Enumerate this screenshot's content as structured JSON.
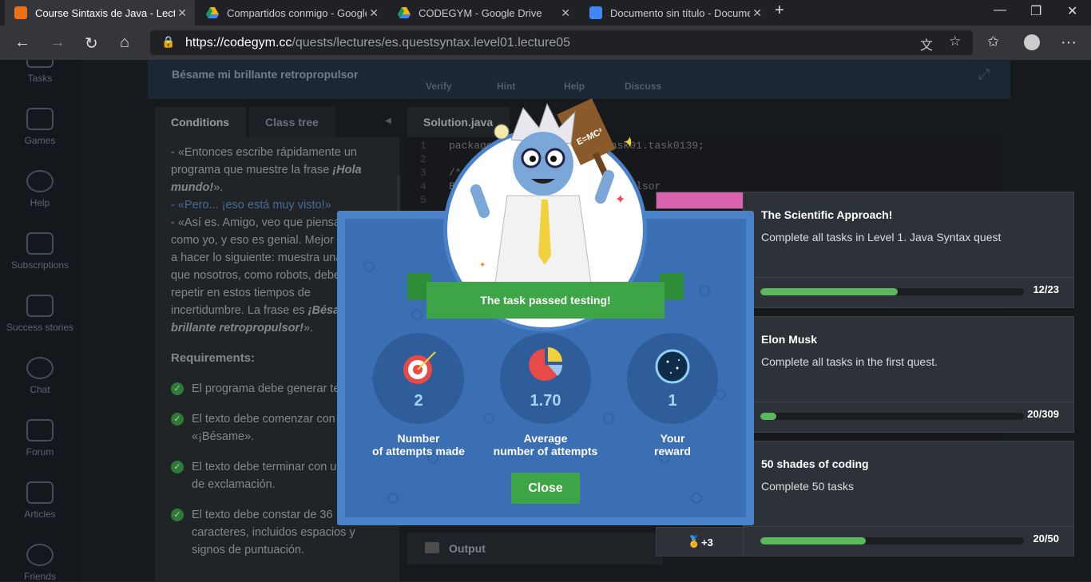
{
  "browser": {
    "tabs": [
      {
        "title": "Course Sintaxis de Java - Lecture",
        "active": true
      },
      {
        "title": "Compartidos conmigo - Google Dr",
        "active": false
      },
      {
        "title": "CODEGYM - Google Drive",
        "active": false
      },
      {
        "title": "Documento sin título - Documen",
        "active": false
      }
    ],
    "url_host": "https://codegym.cc",
    "url_path": "/quests/lectures/es.questsyntax.level01.lecture05"
  },
  "sidebar": {
    "items": [
      {
        "label": "Tasks",
        "icon": "tasks-icon"
      },
      {
        "label": "Games",
        "icon": "gamepad-icon"
      },
      {
        "label": "Help",
        "icon": "help-icon"
      },
      {
        "label": "Subscriptions",
        "icon": "subscriptions-icon"
      },
      {
        "label": "Success stories",
        "icon": "flag-icon"
      },
      {
        "label": "Chat",
        "icon": "chat-icon"
      },
      {
        "label": "Forum",
        "icon": "forum-icon"
      },
      {
        "label": "Articles",
        "icon": "articles-icon"
      },
      {
        "label": "Friends",
        "icon": "friends-icon"
      }
    ]
  },
  "task": {
    "title": "Bésame mi brillante retropropulsor",
    "actions": [
      "Verify",
      "Hint",
      "Help",
      "Discuss"
    ],
    "tabs": [
      "Conditions",
      "Class tree"
    ],
    "file_tab": "Solution.java",
    "output_label": "Output"
  },
  "conditions": {
    "p1_before": "- «Entonces escribe rápidamente un programa que muestre la frase ",
    "p1_em": "¡Hola mundo!",
    "p1_after": "».",
    "p2": "- «Pero... ¡eso está muy visto!»",
    "p3_before": "- «Así es. Amigo, veo que piensas como yo, y eso es genial. Mejor vamos a hacer lo siguiente: muestra una frase que nosotros, como robots, debemos repetir en estos tiempos de incertidumbre. La frase es ",
    "p3_em": "¡Bésame mi brillante retropropulsor!",
    "p3_after": "».",
    "requirements_title": "Requirements:",
    "requirements": [
      "El programa debe generar texto.",
      "El texto debe comenzar con «¡Bésame».",
      "El texto debe terminar con un signo de exclamación.",
      "El texto debe constar de 36 caracteres, incluidos espacios y signos de puntuación."
    ]
  },
  "code_lines": [
    "package com.codegym.task.task01.task0139;",
    "",
    "/*",
    "Bésame mi brillante retropropulsor",
    ""
  ],
  "achievements": [
    {
      "title": "The Scientific Approach!",
      "desc": "Complete all tasks in Level 1. Java Syntax quest",
      "count": "12/23",
      "progress": 0.52
    },
    {
      "title": "Elon Musk",
      "desc": "Complete all tasks in the first quest.",
      "count": "20/309",
      "progress": 0.06
    },
    {
      "title": "50 shades of coding",
      "desc": "Complete 50 tasks",
      "count": "20/50",
      "progress": 0.4
    }
  ],
  "reward_badge": "+3",
  "modal": {
    "banner": "The task passed testing!",
    "stats": [
      {
        "value": "2",
        "label1": "Number",
        "label2": "of attempts made",
        "icon": "target-icon"
      },
      {
        "value": "1.70",
        "label1": "Average",
        "label2": "number of attempts",
        "icon": "pie-chart-icon"
      },
      {
        "value": "1",
        "label1": "Your",
        "label2": "reward",
        "icon": "dark-matter-icon"
      }
    ],
    "close_label": "Close",
    "sign_text": "E=MC²"
  }
}
